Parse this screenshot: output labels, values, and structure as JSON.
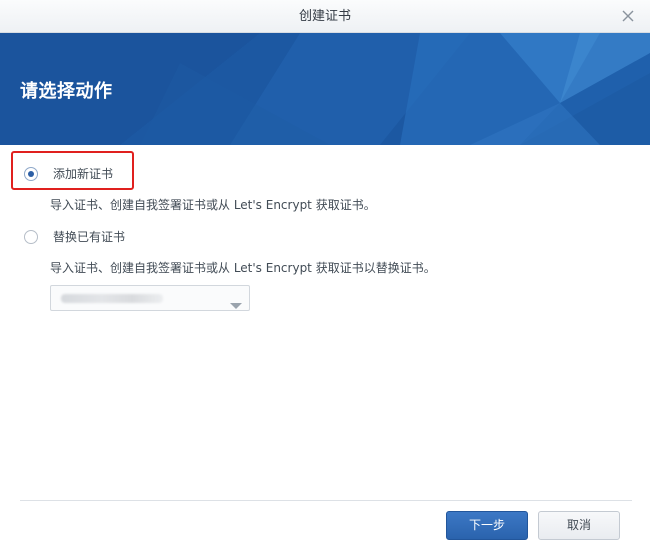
{
  "window": {
    "title": "创建证书"
  },
  "banner": {
    "heading": "请选择动作"
  },
  "options": [
    {
      "label": "添加新证书",
      "checked": true,
      "description": "导入证书、创建自我签署证书或从 Let's Encrypt 获取证书。"
    },
    {
      "label": "替换已有证书",
      "checked": false,
      "description": "导入证书、创建自我签署证书或从 Let's Encrypt 获取证书以替换证书。"
    }
  ],
  "footer": {
    "next_label": "下一步",
    "cancel_label": "取消"
  },
  "colors": {
    "banner": "#1d5aa4",
    "primary_button": "#2c68b3",
    "highlight": "#e0201e"
  }
}
